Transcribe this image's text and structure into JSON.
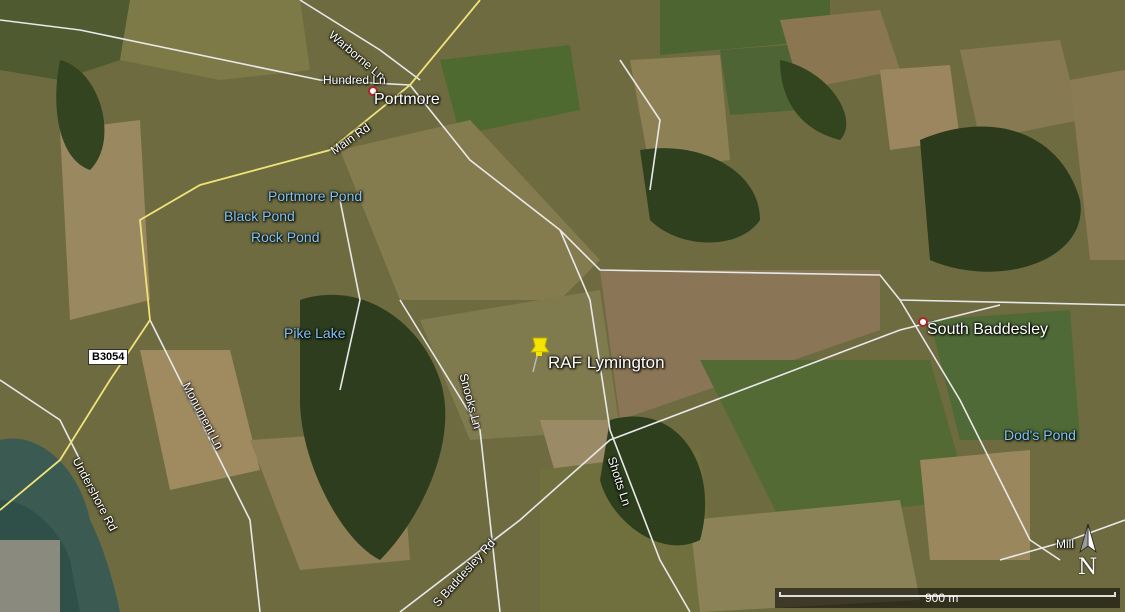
{
  "places": {
    "portmore": "Portmore",
    "south_baddesley": "South Baddesley"
  },
  "water": {
    "portmore_pond": "Portmore Pond",
    "black_pond": "Black Pond",
    "rock_pond": "Rock Pond",
    "pike_lake": "Pike Lake",
    "dods_pond": "Dod's Pond"
  },
  "roads": {
    "warborne": "Warborne Ln",
    "hundred": "Hundred Ln",
    "main": "Main Rd",
    "monument": "Monument Ln",
    "undershore": "Undershore Rd",
    "snooks": "Snooks Ln",
    "shotts": "Shotts Ln",
    "s_baddesley": "S Baddesley Rd",
    "mill": "Mill",
    "b3054": "B3054"
  },
  "poi": {
    "raf_lymington": "RAF Lymington",
    "marker_color": "#f5e400"
  },
  "compass": {
    "label": "N"
  },
  "scale": {
    "label": "900 m"
  },
  "colors": {
    "road_minor": "#e8e8e8",
    "road_major": "#efe27a",
    "water_label": "#7fc3f2"
  }
}
